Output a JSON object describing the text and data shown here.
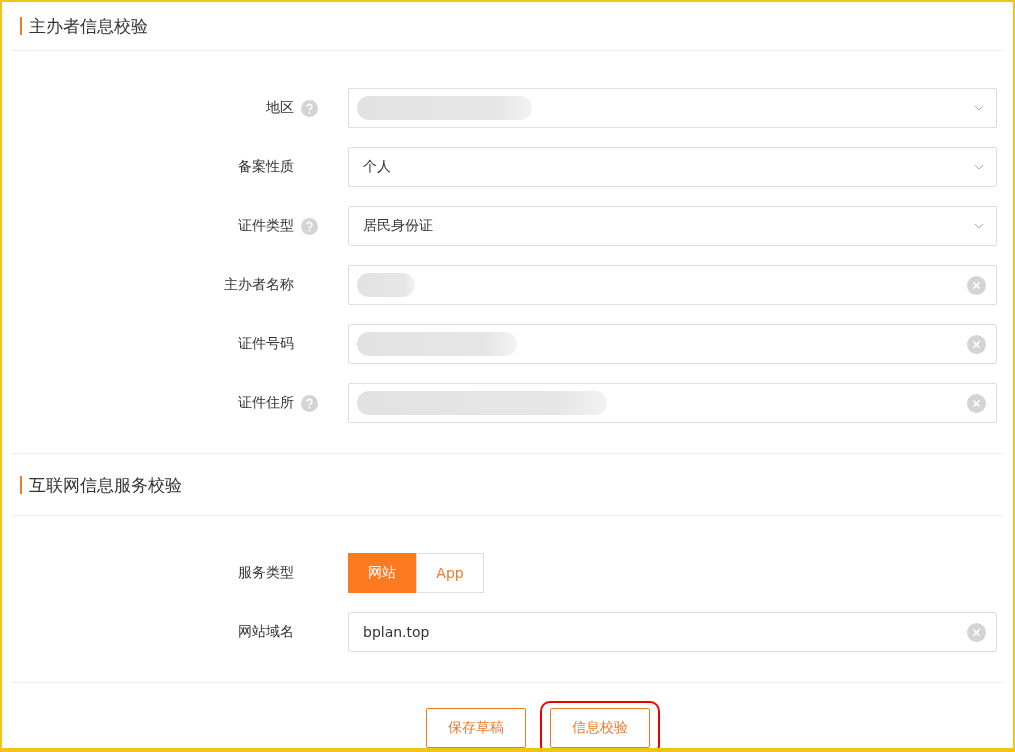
{
  "sections": [
    {
      "title": "主办者信息校验",
      "fields": [
        {
          "label": "地区",
          "help": true,
          "kind": "select",
          "redacted": true
        },
        {
          "label": "备案性质",
          "help": false,
          "kind": "select",
          "value": "个人"
        },
        {
          "label": "证件类型",
          "help": true,
          "kind": "select",
          "value": "居民身份证"
        },
        {
          "label": "主办者名称",
          "help": false,
          "kind": "input",
          "redacted": true
        },
        {
          "label": "证件号码",
          "help": false,
          "kind": "input",
          "redacted": true
        },
        {
          "label": "证件住所",
          "help": true,
          "kind": "input",
          "redacted": true
        }
      ]
    },
    {
      "title": "互联网信息服务校验",
      "fields": [
        {
          "label": "服务类型",
          "help": false,
          "kind": "segmented",
          "options": [
            {
              "label": "网站",
              "selected": true
            },
            {
              "label": "App",
              "selected": false
            }
          ]
        },
        {
          "label": "网站域名",
          "help": false,
          "kind": "input",
          "value": "bplan.top"
        }
      ]
    }
  ],
  "buttons": [
    {
      "label": "保存草稿",
      "highlighted": false
    },
    {
      "label": "信息校验",
      "highlighted": true
    }
  ]
}
